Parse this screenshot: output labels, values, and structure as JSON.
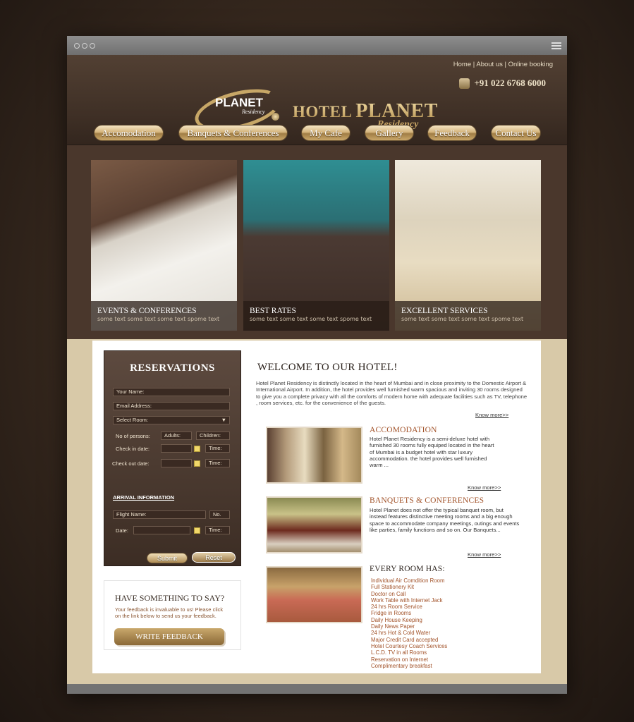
{
  "toplinks": [
    "Home",
    "About us",
    "Online booking"
  ],
  "phone": "+91 022 6768 6000",
  "logo": {
    "word": "PLANET",
    "sub": "Residency"
  },
  "hotel": {
    "prefix": "HOTEL ",
    "main": "PLANET",
    "sub": "Residency"
  },
  "nav": [
    "Accomodation",
    "Banquets & Conferences",
    "My Cafe",
    "Gallery",
    "Feedback",
    "Contact Us"
  ],
  "cards": [
    {
      "title": "EVENTS & CONFERENCES",
      "sub": "some text some text some text spome text"
    },
    {
      "title": "BEST RATES",
      "sub": "some text some text some text spome text"
    },
    {
      "title": "EXCELLENT SERVICES",
      "sub": "some text some text some text spome text"
    }
  ],
  "reservations": {
    "title": "RESERVATIONS",
    "your_name": "Your Name:",
    "email": "Email Address:",
    "select_room": "Select Room:",
    "persons": "No of persons:",
    "adults": "Adults:",
    "children": "Children:",
    "checkin": "Check in date:",
    "checkout": "Check out date:",
    "time": "Time:",
    "arrival": "ARRIVAL INFORMATION",
    "flight": "Flight Name:",
    "no": "No.",
    "date": "Date:",
    "submit": "Submit",
    "reset": "Reset"
  },
  "feedback": {
    "title": "HAVE SOMETHING TO SAY?",
    "text": "Your feedback is invaluable to us! Please click on the link below to send us your feedback.",
    "button": "WRITE FEEDBACK"
  },
  "welcome": {
    "title": "WELCOME TO OUR HOTEL!",
    "text": "Hotel Planet Residency is distinctly located in the heart of Mumbai and in close proximity to the Domestic Airport & International Airport. In addition, the hotel provides well furnished warm spacious and inviting 30 rooms designed to give you a complete privacy with all the comforts of modern home with adequate facilities such as TV, telephone , room services, etc. for the convenience of the guests.",
    "more": "Know more>>"
  },
  "accomodation": {
    "title": "ACCOMODATION",
    "text": "Hotel Planet Residency is a semi-deluxe hotel with furnished 30 rooms fully equiped located in the heart of Mumbai is a budget hotel with star luxury accommodation. the hotel provides well furnished warm ...",
    "more": "Know more>>"
  },
  "banquets": {
    "title": "BANQUETS & CONFERENCES",
    "text": "Hotel Planet does not offer the typical banquet room, but instead features distinctive meeting rooms and a big enough space to accommodate company meetings, outings and events like parties, family functions and so on. Our Banquets...",
    "more": "Know more>>"
  },
  "rooms": {
    "title": "EVERY ROOM HAS:",
    "items": [
      "Individual Air Comdition Room",
      "Full Stationery Kit",
      "Doctor on Call",
      "Work Table with Internet Jack",
      "24 hrs Room Service",
      "Fridge in Rooms",
      "Daily House Keeping",
      "Daily News Paper",
      "24 hrs Hot & Cold Water",
      "Major Credit Card accepted",
      "Hotel Courtesy Coach Services",
      "L.C.D. TV in all Rooms",
      "Reservation on Internet",
      "Complimentary breakfast"
    ]
  }
}
